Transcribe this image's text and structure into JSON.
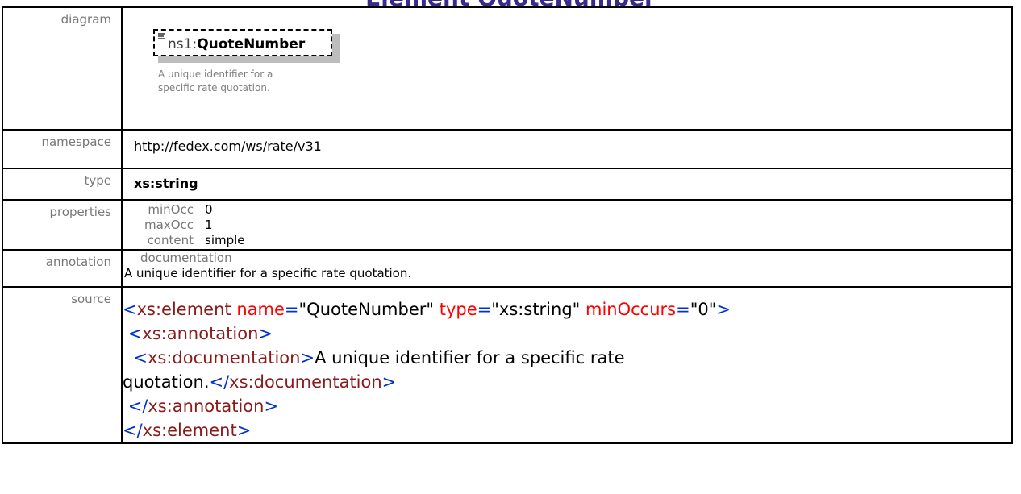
{
  "page": {
    "title": "Element QuoteNumber"
  },
  "labels": {
    "diagram": "diagram",
    "namespace": "namespace",
    "type": "type",
    "properties": "properties",
    "annotation": "annotation",
    "source": "source"
  },
  "diagram": {
    "prefix": "ns1:",
    "local_name": "QuoteNumber",
    "documentation": "A unique identifier for a specific rate quotation.",
    "icon": "documentation-lines-icon"
  },
  "namespace": "http://fedex.com/ws/rate/v31",
  "type": "xs:string",
  "properties": [
    {
      "key": "minOcc",
      "value": "0"
    },
    {
      "key": "maxOcc",
      "value": "1"
    },
    {
      "key": "content",
      "value": "simple"
    }
  ],
  "annotation": {
    "key": "documentation",
    "value": "A unique identifier for a specific rate quotation."
  },
  "source": {
    "open_lt": "<",
    "element_tag": "xs:element",
    "attr_name": "name",
    "eq": "=",
    "name_value": "\"QuoteNumber\"",
    "attr_type": "type",
    "type_value": "\"xs:string\"",
    "attr_minoccurs": "minOccurs",
    "minoccurs_value": "\"0\"",
    "gt": ">",
    "annotation_tag": "xs:annotation",
    "documentation_tag": "xs:documentation",
    "doc_text_1": "A unique identifier for a specific rate",
    "doc_text_2": "quotation.",
    "close_lt": "</"
  },
  "colors": {
    "tag": "#8b1a1a",
    "markup": "#0033cc",
    "attribute": "#ff0000",
    "label": "#777777"
  }
}
